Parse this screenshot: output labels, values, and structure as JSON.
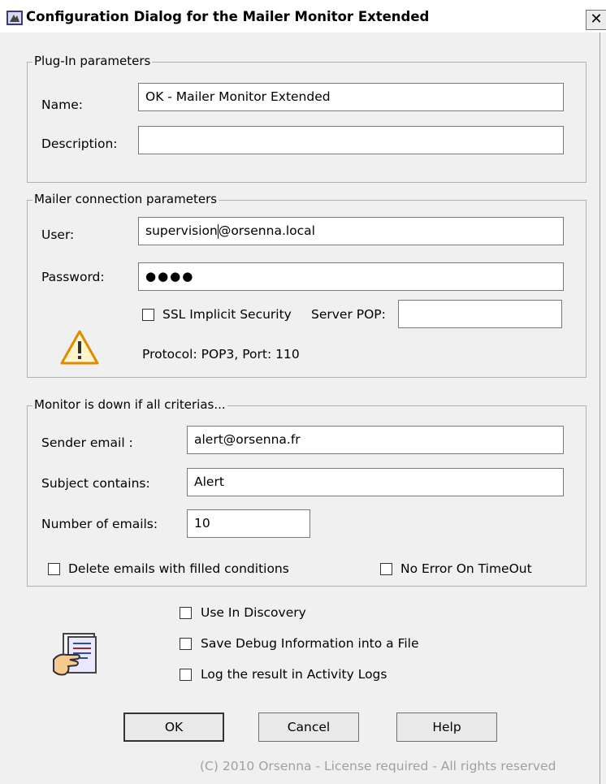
{
  "window": {
    "title": "Configuration Dialog for the Mailer Monitor Extended",
    "close_label": "✕"
  },
  "plugin_group": {
    "title": "Plug-In parameters",
    "name_label": "Name:",
    "name_value": "OK - Mailer Monitor Extended",
    "description_label": "Description:",
    "description_value": ""
  },
  "connection_group": {
    "title": "Mailer connection parameters",
    "user_label": "User:",
    "user_value_before_caret": "supervision",
    "user_value_after_caret": "@orsenna.local",
    "password_label": "Password:",
    "password_value": "●●●●",
    "ssl_label": "SSL Implicit Security",
    "ssl_checked": false,
    "server_pop_label": "Server POP:",
    "server_pop_value": "",
    "protocol_text": "Protocol: POP3, Port: 110",
    "warning_icon": "warning-icon"
  },
  "monitor_group": {
    "title": "Monitor is down if all criterias...",
    "sender_label": "Sender email :",
    "sender_value": "alert@orsenna.fr",
    "subject_label": "Subject contains:",
    "subject_value": "Alert",
    "number_label": "Number of emails:",
    "number_value": "10",
    "delete_label": "Delete emails with filled conditions",
    "delete_checked": false,
    "no_error_label": "No Error On TimeOut",
    "no_error_checked": false
  },
  "options": {
    "use_discovery_label": "Use In Discovery",
    "save_debug_label": "Save Debug Information into a File",
    "log_result_label": "Log the result in Activity Logs",
    "icon": "hand-document-icon"
  },
  "buttons": {
    "ok": "OK",
    "cancel": "Cancel",
    "help": "Help"
  },
  "footer": "(C) 2010 Orsenna - License required - All rights reserved"
}
